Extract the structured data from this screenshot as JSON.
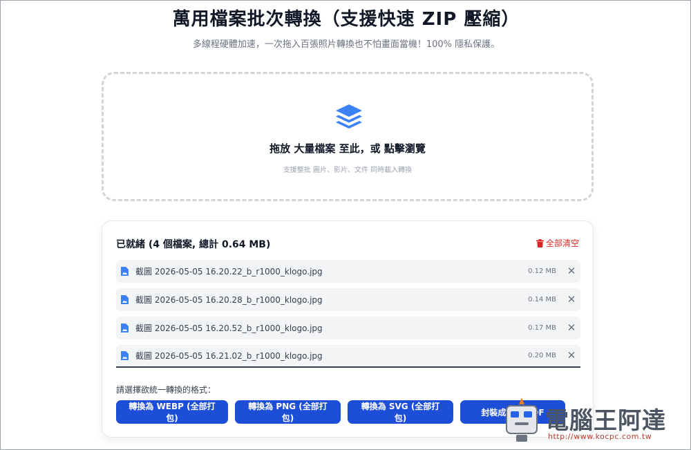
{
  "header": {
    "title": "萬用檔案批次轉換（支援快速 ZIP 壓縮）",
    "subtitle": "多線程硬體加速，一次拖入百張照片轉換也不怕畫面當機！100% 隱私保護。"
  },
  "dropzone": {
    "icon": "layers-icon",
    "main_text": "拖放 大量檔案 至此，或 點擊瀏覽",
    "hint_text": "支援整批 圖片、影片、文件 同時載入轉換",
    "accent_color": "#3b82f6"
  },
  "panel": {
    "status": "已就緒 (4 個檔案, 總計 0.64 MB)",
    "clear_all": "全部清空",
    "files": [
      {
        "name": "截圖 2026-05-05 16.20.22_b_r1000_klogo.jpg",
        "size": "0.12 MB"
      },
      {
        "name": "截圖 2026-05-05 16.20.28_b_r1000_klogo.jpg",
        "size": "0.14 MB"
      },
      {
        "name": "截圖 2026-05-05 16.20.52_b_r1000_klogo.jpg",
        "size": "0.17 MB"
      },
      {
        "name": "截圖 2026-05-05 16.21.02_b_r1000_klogo.jpg",
        "size": "0.20 MB"
      }
    ],
    "remove_symbol": "✕",
    "format_label": "請選擇欲統一轉換的格式：",
    "buttons": [
      "轉換為 WEBP (全部打包)",
      "轉換為 PNG (全部打包)",
      "轉換為 SVG (全部打包)",
      "封裝成一個 PDF"
    ],
    "button_color": "#1d4ed8",
    "danger_color": "#dc2626"
  },
  "watermark": {
    "text": "電腦王阿達",
    "url": "http://www.kocpc.com.tw"
  }
}
